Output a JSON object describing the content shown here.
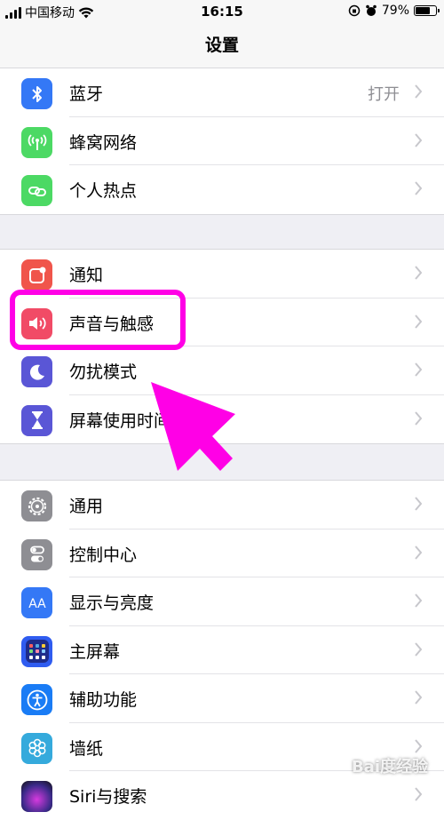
{
  "status_bar": {
    "carrier": "中国移动",
    "time": "16:15",
    "battery": "79%",
    "battery_level": 0.79
  },
  "nav": {
    "title": "设置"
  },
  "group1": [
    {
      "label": "蓝牙",
      "value": "打开",
      "icon": "bluetooth-icon",
      "color": "#3478f6"
    },
    {
      "label": "蜂窝网络",
      "icon": "cellular-icon",
      "color": "#4cd964"
    },
    {
      "label": "个人热点",
      "icon": "hotspot-icon",
      "color": "#4cd964"
    }
  ],
  "group2": [
    {
      "label": "通知",
      "icon": "notifications-icon",
      "color": "#f0554b"
    },
    {
      "label": "声音与触感",
      "icon": "sound-icon",
      "color": "#f14b66"
    },
    {
      "label": "勿扰模式",
      "icon": "moon-icon",
      "color": "#5a56d6"
    },
    {
      "label": "屏幕使用时间",
      "icon": "hourglass-icon",
      "color": "#5a56d6"
    }
  ],
  "group3": [
    {
      "label": "通用",
      "icon": "gear-icon",
      "color": "#8e8e93"
    },
    {
      "label": "控制中心",
      "icon": "toggles-icon",
      "color": "#8e8e93"
    },
    {
      "label": "显示与亮度",
      "icon": "display-icon",
      "color": "#3478f6"
    },
    {
      "label": "主屏幕",
      "icon": "home-screen-icon",
      "color": "#2f5cf0"
    },
    {
      "label": "辅助功能",
      "icon": "accessibility-icon",
      "color": "#1a7cf5"
    },
    {
      "label": "墙纸",
      "icon": "wallpaper-icon",
      "color": "#35aadc"
    },
    {
      "label": "Siri与搜索",
      "icon": "siri-icon",
      "color": "#222222"
    }
  ],
  "watermark": "Bai度经验"
}
